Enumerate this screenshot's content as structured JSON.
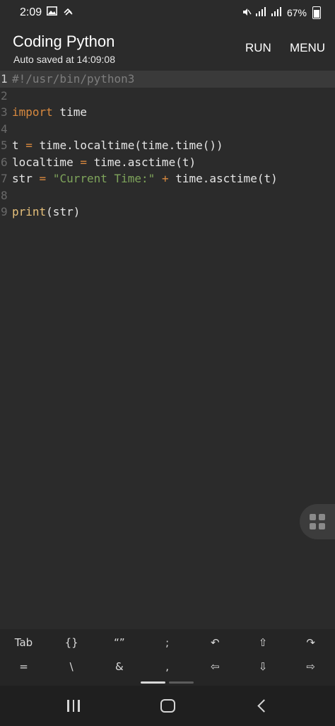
{
  "status_bar": {
    "time": "2:09",
    "battery": "67%",
    "left_icons": [
      "gallery-icon",
      "sync-icon"
    ],
    "right_icons": [
      "mute-icon",
      "wifi-signal-icon",
      "cell-signal-icon",
      "battery-icon"
    ]
  },
  "app_bar": {
    "title": "Coding Python",
    "subtitle": "Auto saved at 14:09:08",
    "run_label": "RUN",
    "menu_label": "MENU"
  },
  "editor": {
    "lines": [
      {
        "num": "1",
        "tokens": [
          {
            "t": "#!/usr/bin/python3",
            "k": "comment"
          }
        ]
      },
      {
        "num": "2",
        "tokens": []
      },
      {
        "num": "3",
        "tokens": [
          {
            "t": "import",
            "k": "keyword"
          },
          {
            "t": " time",
            "k": "plain"
          }
        ]
      },
      {
        "num": "4",
        "tokens": []
      },
      {
        "num": "5",
        "tokens": [
          {
            "t": "t ",
            "k": "plain"
          },
          {
            "t": "=",
            "k": "op"
          },
          {
            "t": " time.localtime(time.time())",
            "k": "plain"
          }
        ]
      },
      {
        "num": "6",
        "tokens": [
          {
            "t": "localtime ",
            "k": "plain"
          },
          {
            "t": "=",
            "k": "op"
          },
          {
            "t": " time.asctime(t)",
            "k": "plain"
          }
        ]
      },
      {
        "num": "7",
        "tokens": [
          {
            "t": "str ",
            "k": "plain"
          },
          {
            "t": "=",
            "k": "op"
          },
          {
            "t": " ",
            "k": "plain"
          },
          {
            "t": "\"Current Time:\"",
            "k": "string"
          },
          {
            "t": " ",
            "k": "plain"
          },
          {
            "t": "+",
            "k": "op"
          },
          {
            "t": " time.asctime(t)",
            "k": "plain"
          }
        ]
      },
      {
        "num": "8",
        "tokens": []
      },
      {
        "num": "9",
        "tokens": [
          {
            "t": "print",
            "k": "builtin"
          },
          {
            "t": "(str)",
            "k": "plain"
          }
        ]
      }
    ],
    "active_line": 0
  },
  "symbol_bar": {
    "row1": [
      "Tab",
      "{}",
      "“”",
      ";",
      "↶",
      "⇧",
      "↷"
    ],
    "row2": [
      "=",
      "\\",
      "&",
      ",",
      "⇦",
      "⇩",
      "⇨"
    ]
  },
  "colors": {
    "background": "#2b2b2b",
    "keyword": "#d8893f",
    "string": "#7fa55b",
    "comment": "#7d7d7d",
    "builtin": "#e6c07b"
  }
}
